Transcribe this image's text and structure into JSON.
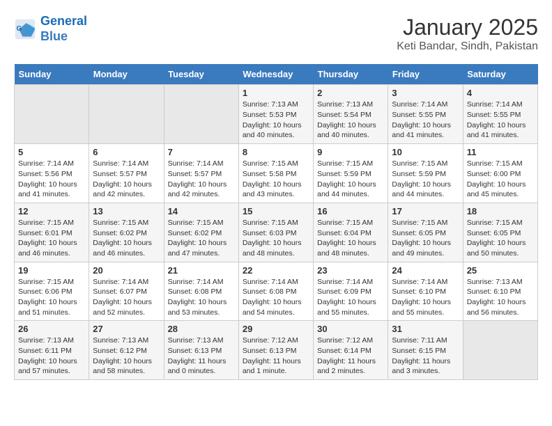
{
  "logo": {
    "line1": "General",
    "line2": "Blue"
  },
  "title": "January 2025",
  "subtitle": "Keti Bandar, Sindh, Pakistan",
  "days_of_week": [
    "Sunday",
    "Monday",
    "Tuesday",
    "Wednesday",
    "Thursday",
    "Friday",
    "Saturday"
  ],
  "weeks": [
    [
      {
        "day": "",
        "empty": true
      },
      {
        "day": "",
        "empty": true
      },
      {
        "day": "",
        "empty": true
      },
      {
        "day": "1",
        "sunrise": "7:13 AM",
        "sunset": "5:53 PM",
        "daylight": "10 hours and 40 minutes."
      },
      {
        "day": "2",
        "sunrise": "7:13 AM",
        "sunset": "5:54 PM",
        "daylight": "10 hours and 40 minutes."
      },
      {
        "day": "3",
        "sunrise": "7:14 AM",
        "sunset": "5:55 PM",
        "daylight": "10 hours and 41 minutes."
      },
      {
        "day": "4",
        "sunrise": "7:14 AM",
        "sunset": "5:55 PM",
        "daylight": "10 hours and 41 minutes."
      }
    ],
    [
      {
        "day": "5",
        "sunrise": "7:14 AM",
        "sunset": "5:56 PM",
        "daylight": "10 hours and 41 minutes."
      },
      {
        "day": "6",
        "sunrise": "7:14 AM",
        "sunset": "5:57 PM",
        "daylight": "10 hours and 42 minutes."
      },
      {
        "day": "7",
        "sunrise": "7:14 AM",
        "sunset": "5:57 PM",
        "daylight": "10 hours and 42 minutes."
      },
      {
        "day": "8",
        "sunrise": "7:15 AM",
        "sunset": "5:58 PM",
        "daylight": "10 hours and 43 minutes."
      },
      {
        "day": "9",
        "sunrise": "7:15 AM",
        "sunset": "5:59 PM",
        "daylight": "10 hours and 44 minutes."
      },
      {
        "day": "10",
        "sunrise": "7:15 AM",
        "sunset": "5:59 PM",
        "daylight": "10 hours and 44 minutes."
      },
      {
        "day": "11",
        "sunrise": "7:15 AM",
        "sunset": "6:00 PM",
        "daylight": "10 hours and 45 minutes."
      }
    ],
    [
      {
        "day": "12",
        "sunrise": "7:15 AM",
        "sunset": "6:01 PM",
        "daylight": "10 hours and 46 minutes."
      },
      {
        "day": "13",
        "sunrise": "7:15 AM",
        "sunset": "6:02 PM",
        "daylight": "10 hours and 46 minutes."
      },
      {
        "day": "14",
        "sunrise": "7:15 AM",
        "sunset": "6:02 PM",
        "daylight": "10 hours and 47 minutes."
      },
      {
        "day": "15",
        "sunrise": "7:15 AM",
        "sunset": "6:03 PM",
        "daylight": "10 hours and 48 minutes."
      },
      {
        "day": "16",
        "sunrise": "7:15 AM",
        "sunset": "6:04 PM",
        "daylight": "10 hours and 48 minutes."
      },
      {
        "day": "17",
        "sunrise": "7:15 AM",
        "sunset": "6:05 PM",
        "daylight": "10 hours and 49 minutes."
      },
      {
        "day": "18",
        "sunrise": "7:15 AM",
        "sunset": "6:05 PM",
        "daylight": "10 hours and 50 minutes."
      }
    ],
    [
      {
        "day": "19",
        "sunrise": "7:15 AM",
        "sunset": "6:06 PM",
        "daylight": "10 hours and 51 minutes."
      },
      {
        "day": "20",
        "sunrise": "7:14 AM",
        "sunset": "6:07 PM",
        "daylight": "10 hours and 52 minutes."
      },
      {
        "day": "21",
        "sunrise": "7:14 AM",
        "sunset": "6:08 PM",
        "daylight": "10 hours and 53 minutes."
      },
      {
        "day": "22",
        "sunrise": "7:14 AM",
        "sunset": "6:08 PM",
        "daylight": "10 hours and 54 minutes."
      },
      {
        "day": "23",
        "sunrise": "7:14 AM",
        "sunset": "6:09 PM",
        "daylight": "10 hours and 55 minutes."
      },
      {
        "day": "24",
        "sunrise": "7:14 AM",
        "sunset": "6:10 PM",
        "daylight": "10 hours and 55 minutes."
      },
      {
        "day": "25",
        "sunrise": "7:13 AM",
        "sunset": "6:10 PM",
        "daylight": "10 hours and 56 minutes."
      }
    ],
    [
      {
        "day": "26",
        "sunrise": "7:13 AM",
        "sunset": "6:11 PM",
        "daylight": "10 hours and 57 minutes."
      },
      {
        "day": "27",
        "sunrise": "7:13 AM",
        "sunset": "6:12 PM",
        "daylight": "10 hours and 58 minutes."
      },
      {
        "day": "28",
        "sunrise": "7:13 AM",
        "sunset": "6:13 PM",
        "daylight": "11 hours and 0 minutes."
      },
      {
        "day": "29",
        "sunrise": "7:12 AM",
        "sunset": "6:13 PM",
        "daylight": "11 hours and 1 minute."
      },
      {
        "day": "30",
        "sunrise": "7:12 AM",
        "sunset": "6:14 PM",
        "daylight": "11 hours and 2 minutes."
      },
      {
        "day": "31",
        "sunrise": "7:11 AM",
        "sunset": "6:15 PM",
        "daylight": "11 hours and 3 minutes."
      },
      {
        "day": "",
        "empty": true
      }
    ]
  ],
  "labels": {
    "sunrise": "Sunrise:",
    "sunset": "Sunset:",
    "daylight": "Daylight:"
  }
}
